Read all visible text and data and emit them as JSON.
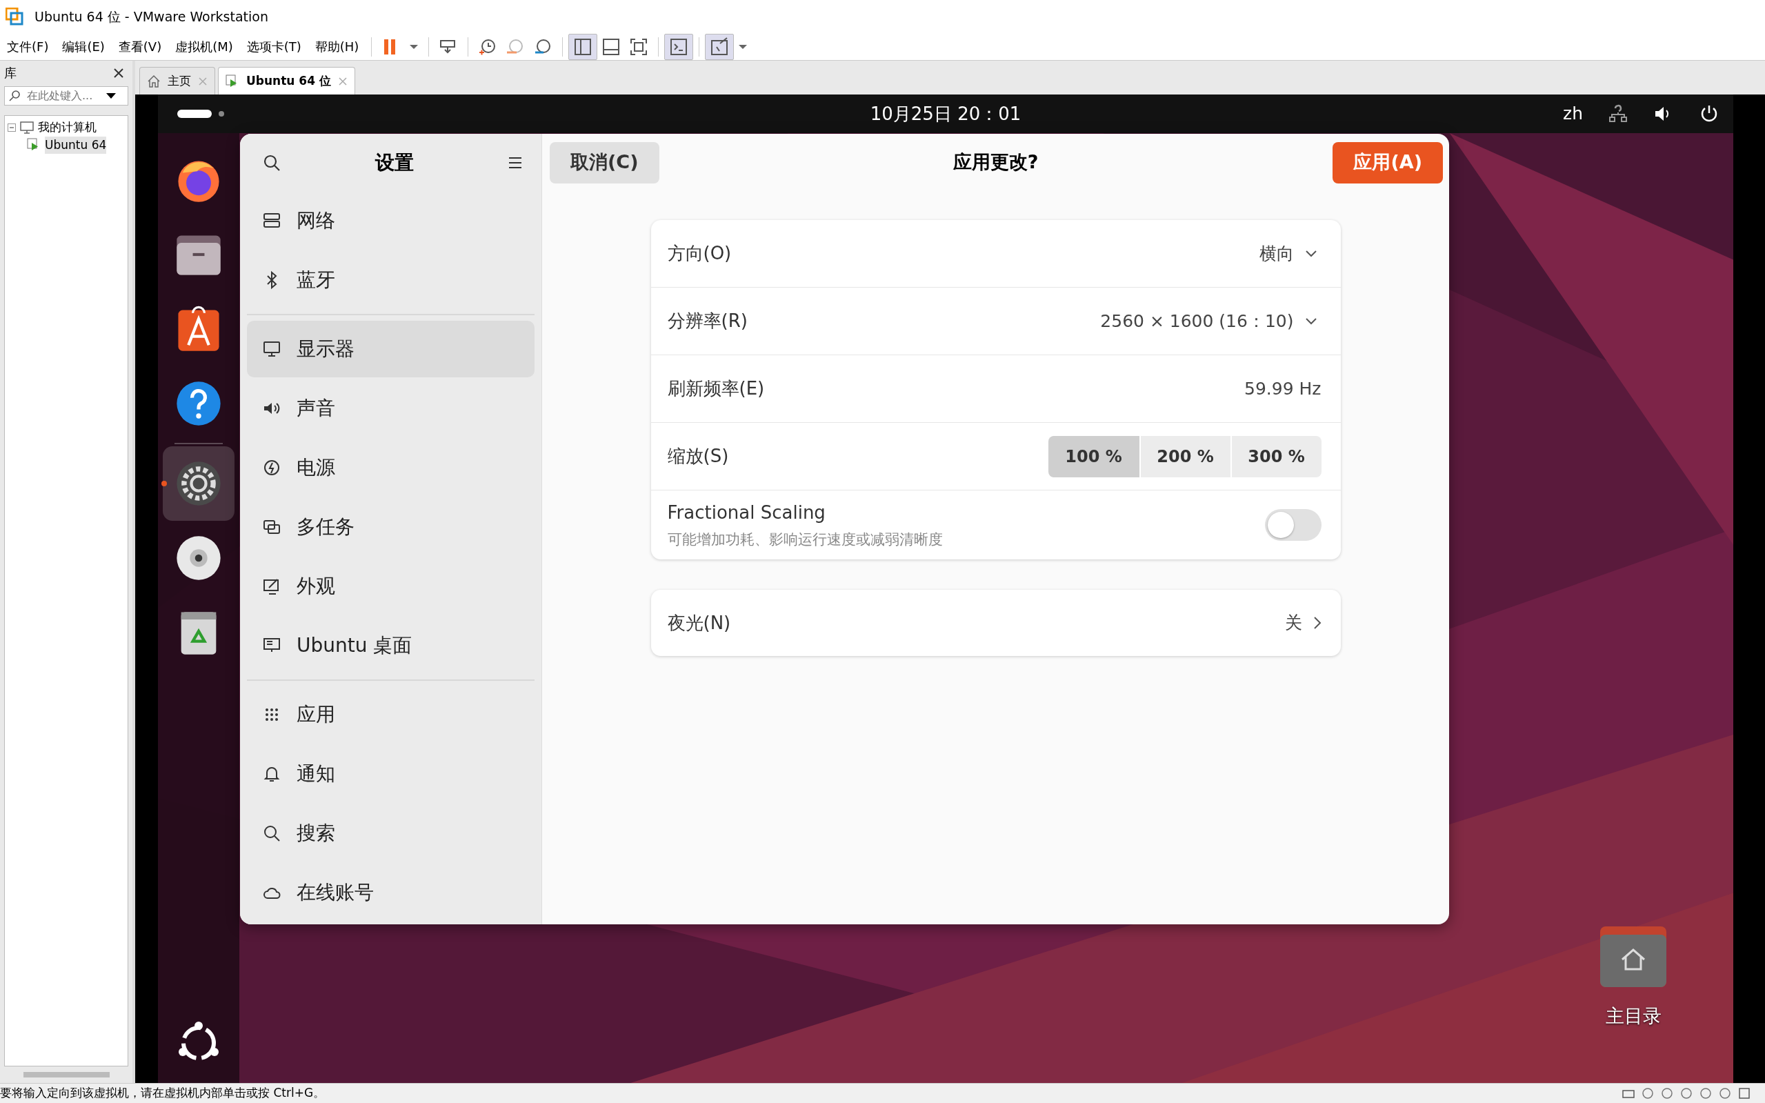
{
  "window": {
    "title": "Ubuntu 64 位 - VMware Workstation"
  },
  "menu": [
    "文件(F)",
    "编辑(E)",
    "查看(V)",
    "虚拟机(M)",
    "选项卡(T)",
    "帮助(H)"
  ],
  "library": {
    "title": "库",
    "search": {
      "placeholder": "在此处键入..."
    },
    "tree": [
      {
        "label": "我的计算机",
        "expanded": true,
        "children": [
          {
            "label": "Ubuntu 64",
            "selected": true
          }
        ]
      }
    ]
  },
  "tabs": [
    {
      "label": "主页",
      "selected": false
    },
    {
      "label": "Ubuntu 64 位",
      "selected": true
    }
  ],
  "ubuntu_top_bar": {
    "clock": "10月25日  20：01",
    "input_method": "zh"
  },
  "dock": [
    {
      "running": false
    },
    {
      "running": false
    },
    {
      "running": false
    },
    {
      "running": false
    },
    {
      "running": true
    },
    {
      "running": false
    },
    {
      "running": false
    }
  ],
  "settings": {
    "title": "设置",
    "sidebar_groups": [
      [
        {
          "label": "网络",
          "selected": false
        },
        {
          "label": "蓝牙",
          "selected": false
        }
      ],
      [
        {
          "label": "显示器",
          "selected": true
        },
        {
          "label": "声音",
          "selected": false
        },
        {
          "label": "电源",
          "selected": false
        },
        {
          "label": "多任务",
          "selected": false
        },
        {
          "label": "外观",
          "selected": false
        },
        {
          "label": "Ubuntu 桌面",
          "selected": false
        }
      ],
      [
        {
          "label": "应用",
          "selected": false
        },
        {
          "label": "通知",
          "selected": false
        },
        {
          "label": "搜索",
          "selected": false
        },
        {
          "label": "在线账号",
          "selected": false
        }
      ]
    ],
    "header": {
      "cancel": "取消(C)",
      "title": "应用更改?",
      "apply": "应用(A)"
    },
    "display_rows": [
      {
        "kind": "dropdown",
        "label": "方向(O)",
        "value": "横向"
      },
      {
        "kind": "dropdown",
        "label": "分辨率(R)",
        "value": "2560 × 1600 (16：10)"
      },
      {
        "kind": "value",
        "label": "刷新频率(E)",
        "value": "59.99 Hz"
      },
      {
        "kind": "scale",
        "label": "缩放(S)",
        "options": [
          {
            "label": "100 %",
            "selected": true
          },
          {
            "label": "200 %",
            "selected": false
          },
          {
            "label": "300 %",
            "selected": false
          }
        ]
      },
      {
        "kind": "toggle",
        "label": "Fractional Scaling",
        "subtitle": "可能增加功耗、影响运行速度或减弱清晰度",
        "on": false
      }
    ],
    "night_light": {
      "label": "夜光(N)",
      "value": "关"
    }
  },
  "desktop_icons": [
    {
      "label": "主目录"
    }
  ],
  "status_bar": {
    "message": "要将输入定向到该虚拟机，请在虚拟机内部单击或按 Ctrl+G。"
  }
}
